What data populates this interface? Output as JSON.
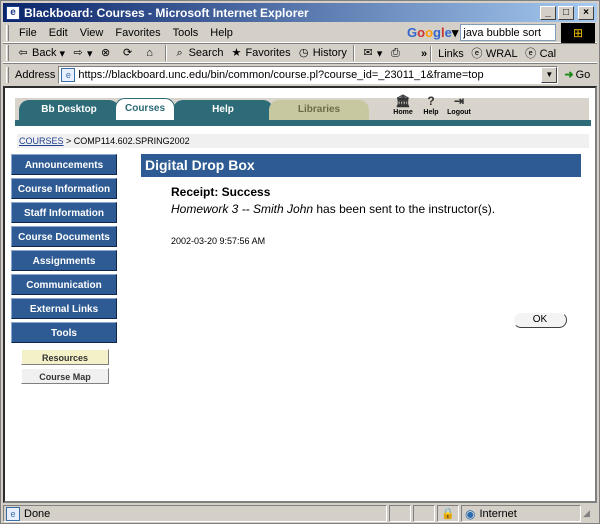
{
  "window": {
    "title": "Blackboard: Courses - Microsoft Internet Explorer",
    "min_label": "_",
    "max_label": "□",
    "close_label": "×"
  },
  "menu": {
    "items": [
      "File",
      "Edit",
      "View",
      "Favorites",
      "Tools",
      "Help"
    ],
    "google_value": "java bubble sort"
  },
  "toolbar": {
    "back_label": "Back",
    "search_label": "Search",
    "favorites_label": "Favorites",
    "history_label": "History",
    "links_label": "Links",
    "link_wral": "WRAL",
    "link_cal": "Cal"
  },
  "address": {
    "label": "Address",
    "url": "https://blackboard.unc.edu/bin/common/course.pl?course_id=_23011_1&frame=top",
    "go_label": "Go"
  },
  "bb_header": {
    "tabs": [
      "Bb Desktop",
      "Courses",
      "Help",
      "Libraries"
    ],
    "icons": [
      "Home",
      "Help",
      "Logout"
    ]
  },
  "breadcrumb": {
    "root": "COURSES",
    "separator": " > ",
    "current": "COMP114.602.SPRING2002"
  },
  "leftnav": {
    "buttons": [
      "Announcements",
      "Course Information",
      "Staff Information",
      "Course Documents",
      "Assignments",
      "Communication",
      "External Links",
      "Tools"
    ],
    "sub_items": [
      "Resources",
      "Course Map"
    ]
  },
  "main": {
    "title": "Digital Drop Box",
    "receipt_heading": "Receipt: Success",
    "receipt_item": "Homework 3 -- Smith John",
    "receipt_suffix": " has been sent to the instructor(s).",
    "timestamp": "2002-03-20 9:57:56 AM",
    "ok_label": "OK"
  },
  "status": {
    "text": "Done",
    "zone": "Internet"
  }
}
